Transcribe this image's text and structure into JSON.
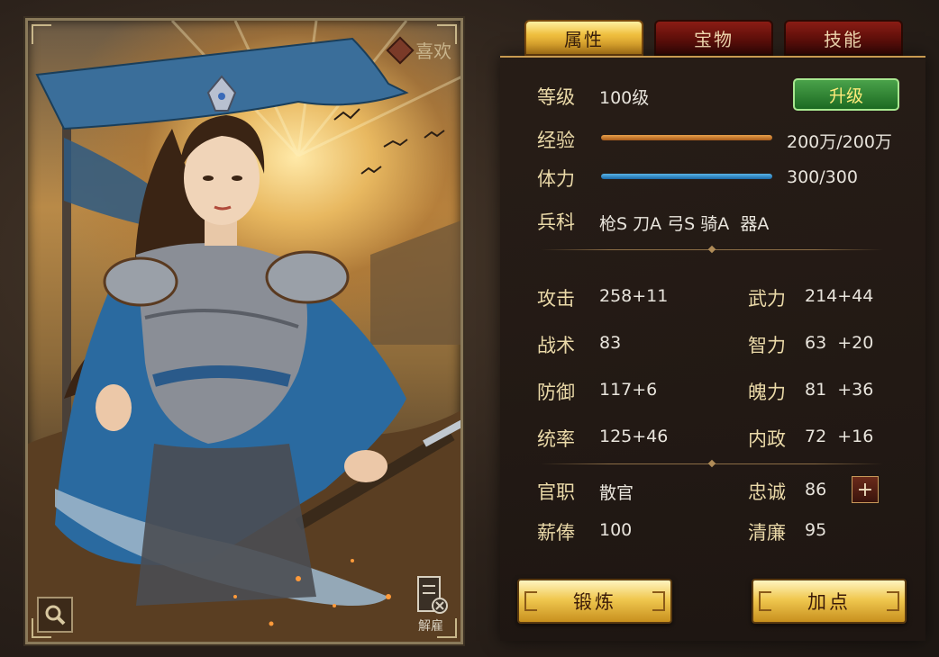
{
  "portrait": {
    "favorite_label": "喜欢",
    "dismiss_label": "解雇"
  },
  "tabs": [
    {
      "label": "属性",
      "active": true
    },
    {
      "label": "宝物",
      "active": false
    },
    {
      "label": "技能",
      "active": false
    }
  ],
  "level": {
    "label": "等级",
    "value": "100级",
    "button": "升级"
  },
  "experience": {
    "label": "经验",
    "value": "200万/200万",
    "fill": 1.0
  },
  "stamina": {
    "label": "体力",
    "value": "300/300",
    "fill": 1.0
  },
  "troops": {
    "label": "兵科",
    "value": "枪S 刀A 弓S 骑A  器A"
  },
  "stats_left": [
    {
      "label": "攻击",
      "value": "258+11"
    },
    {
      "label": "战术",
      "value": "83"
    },
    {
      "label": "防御",
      "value": "117+6"
    },
    {
      "label": "统率",
      "value": "125+46"
    }
  ],
  "stats_right": [
    {
      "label": "武力",
      "value": "214+44"
    },
    {
      "label": "智力",
      "value": "63  +20"
    },
    {
      "label": "魄力",
      "value": "81  +36"
    },
    {
      "label": "内政",
      "value": "72  +16"
    }
  ],
  "office": {
    "label": "官职",
    "value": "散官"
  },
  "salary": {
    "label": "薪俸",
    "value": "100"
  },
  "loyalty": {
    "label": "忠诚",
    "value": "86",
    "plus": "+"
  },
  "integrity": {
    "label": "清廉",
    "value": "95"
  },
  "buttons": {
    "train": "锻炼",
    "add_points": "加点"
  },
  "colors": {
    "accent_gold": "#f0c850",
    "exp_bar": "#c8782a",
    "stamina_bar": "#2a8ad0",
    "levelup_green": "#2e8a34"
  }
}
